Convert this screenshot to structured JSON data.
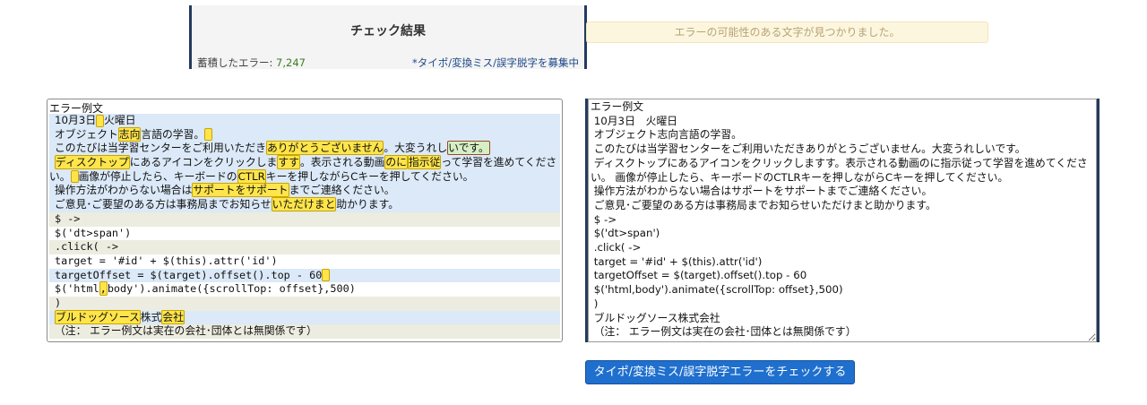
{
  "result": {
    "title": "チェック結果",
    "accumulated_label": "蓄積したエラー: ",
    "accumulated_count": "7,247",
    "recruit_link": "*タイポ/変換ミス/誤字脱字を募集中"
  },
  "notice": "エラーの可能性のある文字が見つかりました。",
  "example": {
    "label": "エラー例文",
    "lines": [
      {
        "bg": "blue",
        "mono": false,
        "parts": [
          {
            "t": "10月3日"
          },
          {
            "t": "",
            "hl": "empty"
          },
          {
            "t": "火曜日"
          }
        ]
      },
      {
        "bg": "blue",
        "mono": false,
        "parts": [
          {
            "t": "オブジェクト"
          },
          {
            "t": "志向",
            "hl": "yellow"
          },
          {
            "t": "言語の学習。"
          },
          {
            "t": "",
            "hl": "empty"
          }
        ]
      },
      {
        "bg": "blue",
        "mono": false,
        "parts": [
          {
            "t": "このたびは当学習センターをご利用いただき"
          },
          {
            "t": "ありがとうございません",
            "hl": "yellow"
          },
          {
            "t": "。大変うれし"
          },
          {
            "t": "いです。",
            "hl": "green"
          }
        ]
      },
      {
        "bg": "blue",
        "mono": false,
        "wrap": true,
        "parts": [
          {
            "t": "ディスクトップ",
            "hl": "yellow"
          },
          {
            "t": "にあるアイコンをクリックしま"
          },
          {
            "t": "すす",
            "hl": "yellow"
          },
          {
            "t": "。表示される動画"
          },
          {
            "t": "のに",
            "hl": "yellow"
          },
          {
            "t": "指示従",
            "hl": "yellow"
          },
          {
            "t": "って学習を進めてください。"
          },
          {
            "t": "",
            "hl": "empty"
          },
          {
            "t": "画像が停止したら、キーボードの"
          },
          {
            "t": "CTLR",
            "hl": "yellow"
          },
          {
            "t": "キーを押しながらCキーを押してください。"
          }
        ]
      },
      {
        "bg": "blue",
        "mono": false,
        "parts": [
          {
            "t": "操作方法がわからない場合は"
          },
          {
            "t": "サポートをサポート",
            "hl": "yellow"
          },
          {
            "t": "までご連絡ください。"
          }
        ]
      },
      {
        "bg": "blue",
        "mono": false,
        "parts": [
          {
            "t": "ご意見･ご要望のある方は事務局までお知らせ"
          },
          {
            "t": "いただけまと",
            "hl": "yellow"
          },
          {
            "t": "助かります。"
          }
        ]
      },
      {
        "bg": "beige",
        "mono": true,
        "parts": [
          {
            "t": "$ ->"
          }
        ]
      },
      {
        "bg": "white",
        "mono": true,
        "parts": [
          {
            "t": "$('dt>span')"
          }
        ]
      },
      {
        "bg": "beige",
        "mono": true,
        "parts": [
          {
            "t": ".click( ->"
          }
        ]
      },
      {
        "bg": "white",
        "mono": true,
        "parts": [
          {
            "t": "target = '#id' + $(this).attr('id')"
          }
        ]
      },
      {
        "bg": "blue",
        "mono": true,
        "parts": [
          {
            "t": "targetOffset = $(target).offset().top - 60"
          },
          {
            "t": "",
            "hl": "empty"
          }
        ]
      },
      {
        "bg": "white",
        "mono": true,
        "parts": [
          {
            "t": "$('html"
          },
          {
            "t": ",",
            "hl": "yellow"
          },
          {
            "t": "body').animate({scrollTop: offset},500)"
          }
        ]
      },
      {
        "bg": "beige",
        "mono": true,
        "parts": [
          {
            "t": ")"
          }
        ]
      },
      {
        "bg": "blue",
        "mono": false,
        "parts": [
          {
            "t": "ブルドッグソース",
            "hl": "yellow"
          },
          {
            "t": "株式"
          },
          {
            "t": "会社",
            "hl": "yellow"
          }
        ]
      },
      {
        "bg": "beige",
        "mono": false,
        "parts": [
          {
            "t": "（注： エラー例文は実在の会社･団体とは無関係です）"
          }
        ]
      }
    ]
  },
  "editor": {
    "content": "エラー例文\n 10月3日　火曜日\n オブジェクト志向言語の学習。\n このたびは当学習センターをご利用いただきありがとうございません。大変うれしいです。\n ディスクトップにあるアイコンをクリックしますす。表示される動画のに指示従って学習を進めてください。 画像が停止したら、キーボードのCTLRキーを押しながらCキーを押してください。\n 操作方法がわからない場合はサポートをサポートまでご連絡ください。\n ご意見･ご要望のある方は事務局までお知らせいただけまと助かります。\n $ ->\n $('dt>span')\n .click( ->\n target = '#id' + $(this).attr('id')\n targetOffset = $(target).offset().top - 60\n $('html,body').animate({scrollTop: offset},500)\n )\n ブルドッグソース株式会社\n （注： エラー例文は実在の会社･団体とは無関係です）"
  },
  "check_button": "タイポ/変換ミス/誤字脱字エラーをチェックする"
}
